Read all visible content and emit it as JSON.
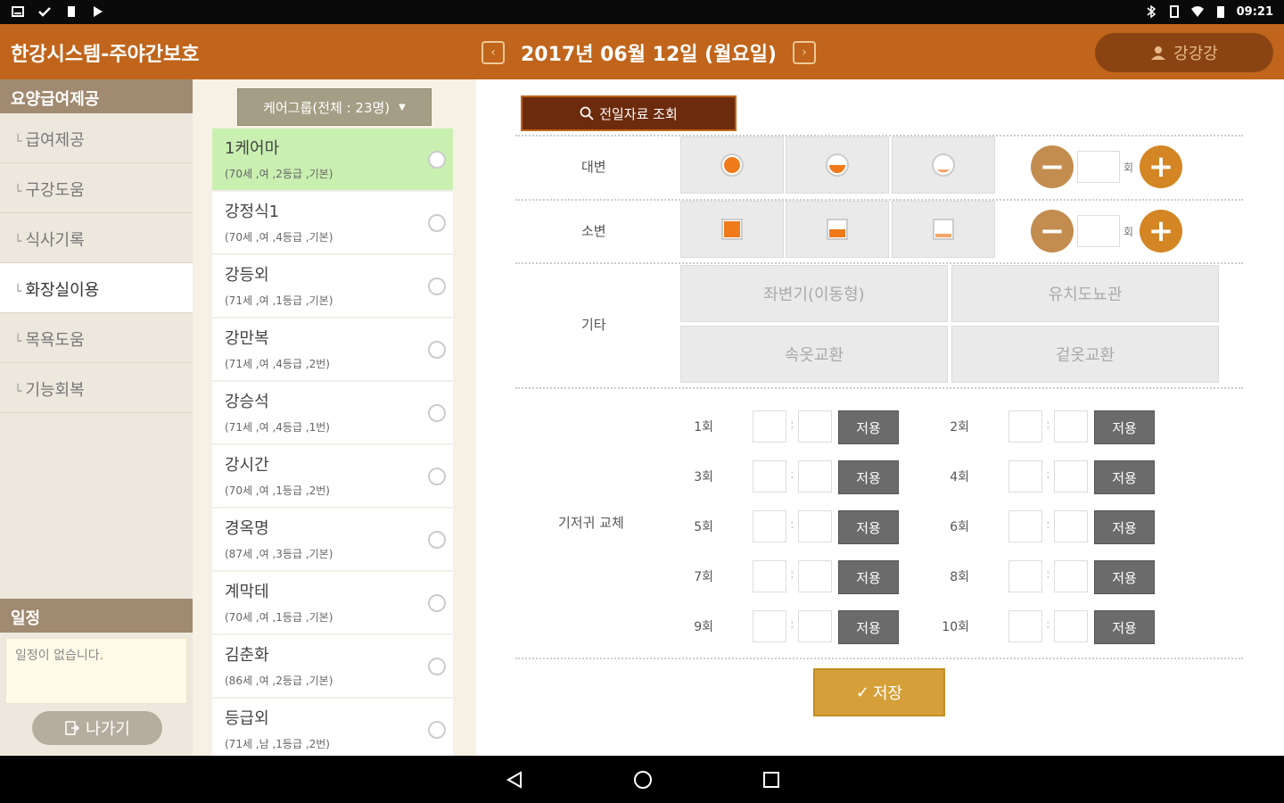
{
  "status_bar": {
    "time": "09:21"
  },
  "header": {
    "app_title": "한강시스템-주야간보호",
    "date": "2017년 06월 12일 (월요일)",
    "user_name": "강강강",
    "prev_arrow_icon": "chevron-left-icon",
    "next_arrow_icon": "chevron-right-icon"
  },
  "sidebar": {
    "title": "요양급여제공",
    "items": [
      {
        "label": "급여제공"
      },
      {
        "label": "구강도움"
      },
      {
        "label": "식사기록"
      },
      {
        "label": "화장실이용"
      },
      {
        "label": "목욕도움"
      },
      {
        "label": "기능회복"
      }
    ],
    "active_index": 3,
    "schedule_title": "일정",
    "schedule_empty": "일정이 없습니다.",
    "exit_label": "나가기"
  },
  "carelist": {
    "group_label": "케어그룹(전체 : 23명)",
    "items": [
      {
        "name": "1케어마",
        "info": "(70세 ,여 ,2등급 ,기본)",
        "selected": true
      },
      {
        "name": "강정식1",
        "info": "(70세 ,여 ,4등급 ,기본)"
      },
      {
        "name": "강등외",
        "info": "(71세 ,여 ,1등급 ,기본)"
      },
      {
        "name": "강만복",
        "info": "(71세 ,여 ,4등급 ,2번)"
      },
      {
        "name": "강승석",
        "info": "(71세 ,여 ,4등급 ,1번)"
      },
      {
        "name": "강시간",
        "info": "(70세 ,여 ,1등급 ,2번)"
      },
      {
        "name": "경옥명",
        "info": "(87세 ,여 ,3등급 ,기본)"
      },
      {
        "name": "계막테",
        "info": "(70세 ,여 ,1등급 ,기본)"
      },
      {
        "name": "김춘화",
        "info": "(86세 ,여 ,2등급 ,기본)"
      },
      {
        "name": "등급외",
        "info": "(71세 ,남 ,1등급 ,2번)"
      }
    ]
  },
  "main": {
    "prev_data_label": "전일자료 조회",
    "stool_label": "대변",
    "urine_label": "소변",
    "etc_label": "기타",
    "count_unit": "회",
    "etc_options": [
      "좌변기(이동형)",
      "유치도뇨관",
      "속옷교환",
      "겉옷교환"
    ],
    "diaper_label": "기저귀 교체",
    "diaper_slots": [
      "1회",
      "2회",
      "3회",
      "4회",
      "5회",
      "6회",
      "7회",
      "8회",
      "9회",
      "10회"
    ],
    "apply_label": "저용",
    "save_label": "저장",
    "colors": {
      "accent": "#c0651b",
      "orange": "#f07a1a"
    }
  }
}
